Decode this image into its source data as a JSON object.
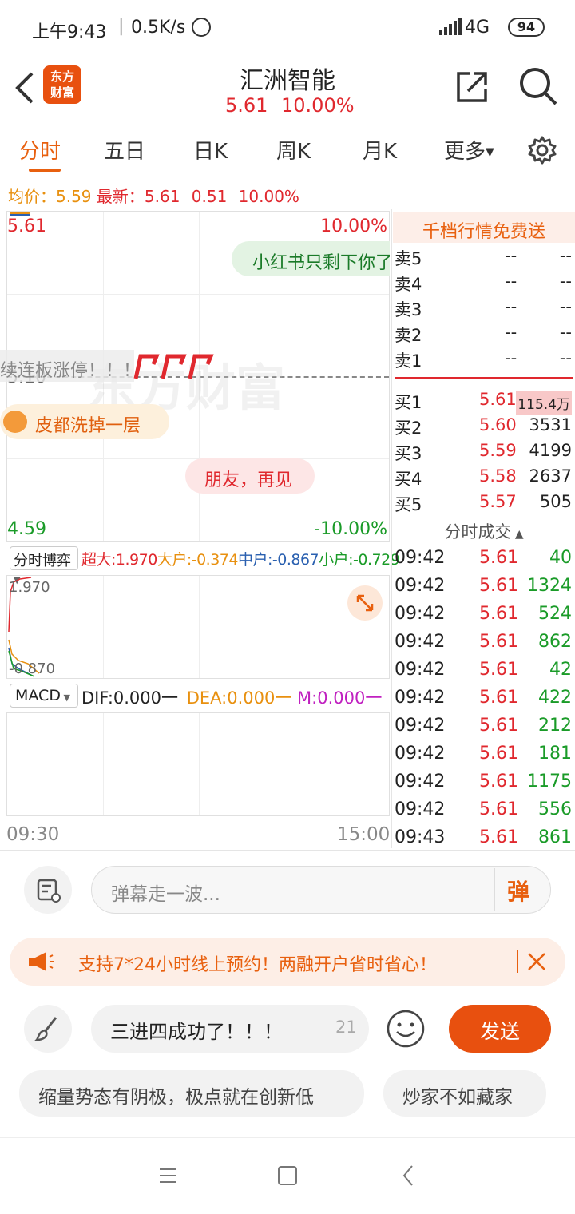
{
  "status": {
    "time": "上午9:43",
    "speed": "0.5K/s",
    "network": "4G",
    "battery": "94"
  },
  "header": {
    "logo_line1": "东方",
    "logo_line2": "财富",
    "title": "汇洲智能",
    "price": "5.61",
    "change_pct": "10.00%"
  },
  "tabs": [
    {
      "label": "分时"
    },
    {
      "label": "五日"
    },
    {
      "label": "日K"
    },
    {
      "label": "周K"
    },
    {
      "label": "月K"
    },
    {
      "label": "更多"
    }
  ],
  "summary": {
    "avg_label": "均价：",
    "avg_value": "5.59",
    "latest_label": "最新：",
    "latest_value": "5.61",
    "change": "0.51",
    "change_pct": "10.00%"
  },
  "chart": {
    "price_high": "5.61",
    "pct_high": "10.00%",
    "price_mid": "5.10",
    "price_low": "4.59",
    "pct_low": "-10.00%",
    "time_start": "09:30",
    "time_end": "15:00",
    "watermark": "东方财富",
    "danmaku": [
      {
        "text": "小红书只剩下你了"
      },
      {
        "text": "续连板涨停！！！"
      },
      {
        "text": "皮都洗掉一层"
      },
      {
        "text": "朋友，再见"
      }
    ]
  },
  "chart_data": {
    "type": "line",
    "x": [
      "09:30",
      "15:00"
    ],
    "ylim": [
      4.59,
      5.61
    ],
    "series": [],
    "reference": 5.1
  },
  "flow": {
    "selector": "分时博弈",
    "super_label": "超大:",
    "super_value": "1.970",
    "large_label": "大户:",
    "large_value": "-0.374",
    "mid_label": "中户:",
    "mid_value": "-0.867",
    "small_label": "小户:",
    "small_value": "-0.729",
    "axis_top": "1.970",
    "axis_bottom": "-0.870"
  },
  "macd": {
    "selector": "MACD",
    "dif": "DIF:0.000一",
    "dea": "DEA:0.000一",
    "m": "M:0.000一"
  },
  "orderbook": {
    "banner": "千档行情免费送",
    "sells": [
      {
        "label": "卖5",
        "price": "--",
        "vol": "--"
      },
      {
        "label": "卖4",
        "price": "--",
        "vol": "--"
      },
      {
        "label": "卖3",
        "price": "--",
        "vol": "--"
      },
      {
        "label": "卖2",
        "price": "--",
        "vol": "--"
      },
      {
        "label": "卖1",
        "price": "--",
        "vol": "--"
      }
    ],
    "buys": [
      {
        "label": "买1",
        "price": "5.61",
        "vol": "115.4万"
      },
      {
        "label": "买2",
        "price": "5.60",
        "vol": "3531"
      },
      {
        "label": "买3",
        "price": "5.59",
        "vol": "4199"
      },
      {
        "label": "买4",
        "price": "5.58",
        "vol": "2637"
      },
      {
        "label": "买5",
        "price": "5.57",
        "vol": "505"
      }
    ],
    "trades_title": "分时成交",
    "trades": [
      {
        "time": "09:42",
        "price": "5.61",
        "vol": "40"
      },
      {
        "time": "09:42",
        "price": "5.61",
        "vol": "1324"
      },
      {
        "time": "09:42",
        "price": "5.61",
        "vol": "524"
      },
      {
        "time": "09:42",
        "price": "5.61",
        "vol": "862"
      },
      {
        "time": "09:42",
        "price": "5.61",
        "vol": "42"
      },
      {
        "time": "09:42",
        "price": "5.61",
        "vol": "422"
      },
      {
        "time": "09:42",
        "price": "5.61",
        "vol": "212"
      },
      {
        "time": "09:42",
        "price": "5.61",
        "vol": "181"
      },
      {
        "time": "09:42",
        "price": "5.61",
        "vol": "1175"
      },
      {
        "time": "09:42",
        "price": "5.61",
        "vol": "556"
      },
      {
        "time": "09:43",
        "price": "5.61",
        "vol": "861"
      }
    ]
  },
  "danmaku_bar": {
    "placeholder": "弹幕走一波...",
    "toggle": "弹"
  },
  "ad": {
    "text": "支持7*24小时线上预约！两融开户省时省心！"
  },
  "compose": {
    "value": "三进四成功了！！！",
    "count": "21",
    "send": "发送"
  },
  "suggestions": [
    {
      "text": "缩量势态有阴极，极点就在创新低"
    },
    {
      "text": "炒家不如藏家"
    }
  ]
}
